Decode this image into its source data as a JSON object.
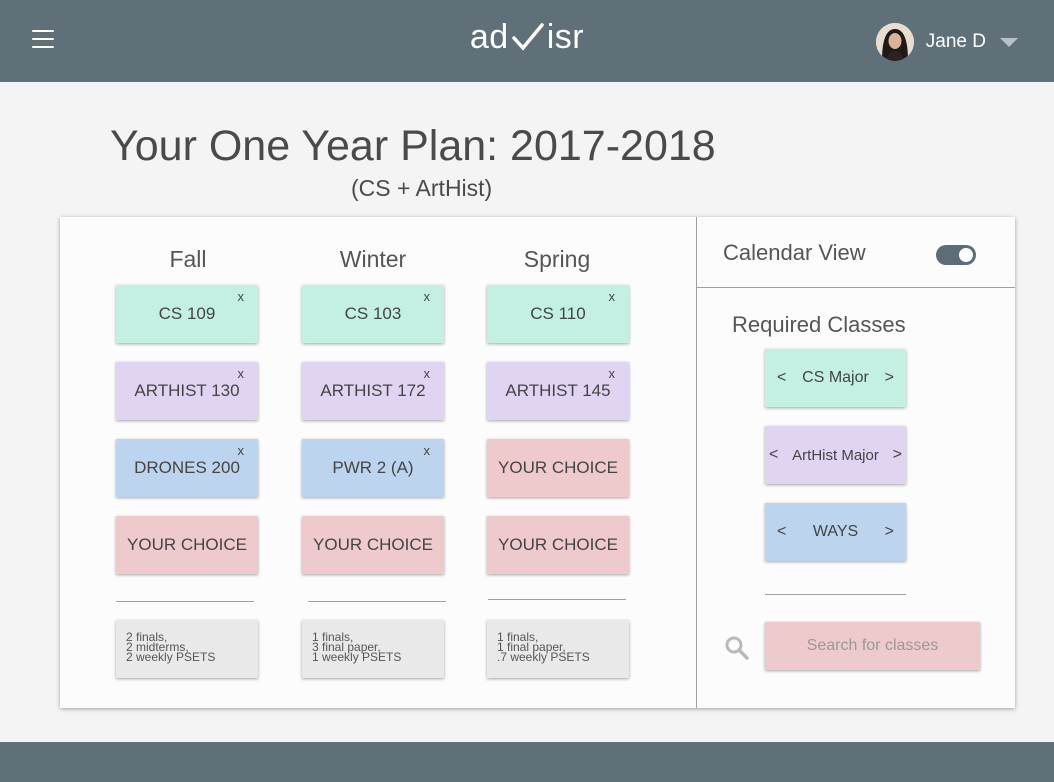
{
  "header": {
    "logo_left": "ad",
    "logo_right": "isr",
    "user_name": "Jane D"
  },
  "page": {
    "title": "Your One Year Plan: 2017-2018",
    "subtitle": "(CS + ArtHist)"
  },
  "quarters": [
    {
      "name": "Fall",
      "classes": [
        {
          "label": "CS 109",
          "color": "#c4f0e3",
          "removable": true
        },
        {
          "label": "ARTHIST 130",
          "color": "#e1d3f2",
          "removable": true
        },
        {
          "label": "DRONES 200",
          "color": "#bdd4ef",
          "removable": true
        },
        {
          "label": "YOUR CHOICE",
          "color": "#efcacc",
          "removable": false
        }
      ],
      "workload": [
        "2 finals,",
        "2 midterms,",
        "2 weekly PSETS"
      ]
    },
    {
      "name": "Winter",
      "classes": [
        {
          "label": "CS 103",
          "color": "#c4f0e3",
          "removable": true
        },
        {
          "label": "ARTHIST 172",
          "color": "#e1d3f2",
          "removable": true
        },
        {
          "label": "PWR 2 (A)",
          "color": "#bdd4ef",
          "removable": true
        },
        {
          "label": "YOUR CHOICE",
          "color": "#efcacc",
          "removable": false
        }
      ],
      "workload": [
        "1 finals,",
        "3 final paper,",
        "1 weekly PSETS"
      ]
    },
    {
      "name": "Spring",
      "classes": [
        {
          "label": "CS 110",
          "color": "#c4f0e3",
          "removable": true
        },
        {
          "label": "ARTHIST 145",
          "color": "#e1d3f2",
          "removable": true
        },
        {
          "label": "YOUR CHOICE",
          "color": "#efcacc",
          "removable": false
        },
        {
          "label": "YOUR CHOICE",
          "color": "#efcacc",
          "removable": false
        }
      ],
      "workload": [
        "1 finals,",
        "1 final paper,",
        ".7 weekly PSETS"
      ]
    }
  ],
  "remove_glyph": "x",
  "sidebar": {
    "calendar_view_label": "Calendar View",
    "calendar_view_on": true,
    "required_label": "Required Classes",
    "required": [
      {
        "label": "CS Major",
        "color": "#c4f0e3"
      },
      {
        "label": "ArtHist Major",
        "color": "#e1d3f2"
      },
      {
        "label": "WAYS",
        "color": "#bdd4ef"
      }
    ],
    "arrow_left": "<",
    "arrow_right": ">",
    "search_placeholder": "Search for classes"
  },
  "colors": {
    "header": "#607079",
    "teal": "#c4f0e3",
    "lavender": "#e1d3f2",
    "blue": "#bdd4ef",
    "pink": "#efcacc"
  }
}
